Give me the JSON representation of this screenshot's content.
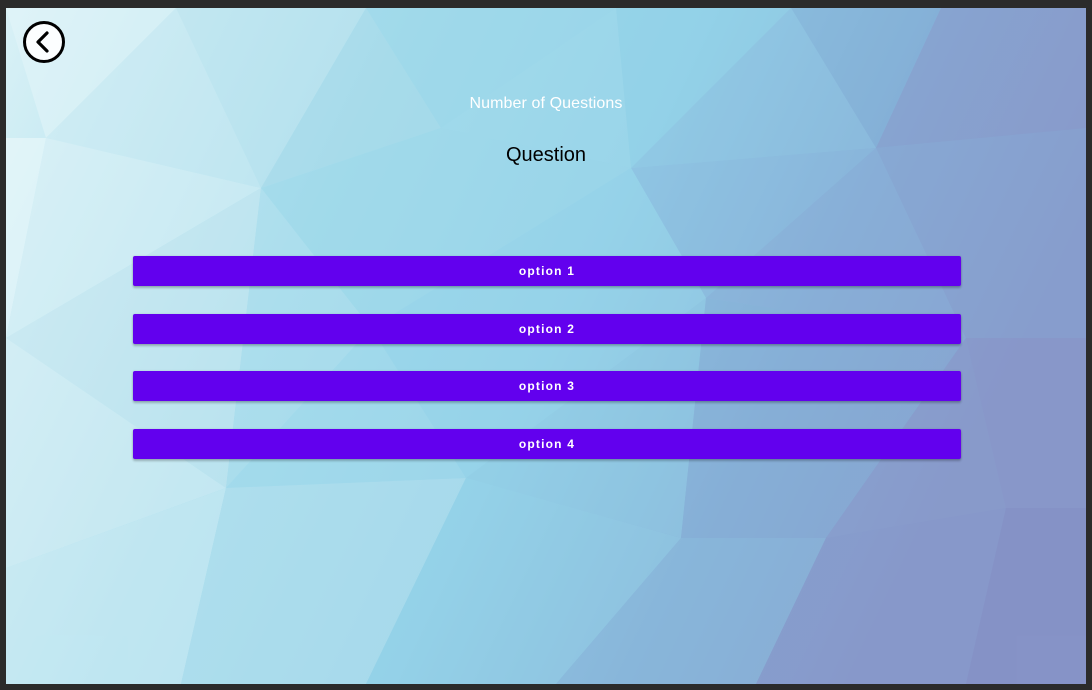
{
  "theme": {
    "button_color": "#6200ee",
    "button_text_color": "#ffffff",
    "background_light": "#dff3f8",
    "background_mid": "#9ed8ea",
    "background_dark": "#8795c9"
  },
  "header": {
    "back_icon": "chevron-left-circle-icon",
    "number_of_questions": "Number of Questions",
    "question": "Question"
  },
  "options": [
    {
      "label": "option 1"
    },
    {
      "label": "option 2"
    },
    {
      "label": "option 3"
    },
    {
      "label": "option 4"
    }
  ]
}
